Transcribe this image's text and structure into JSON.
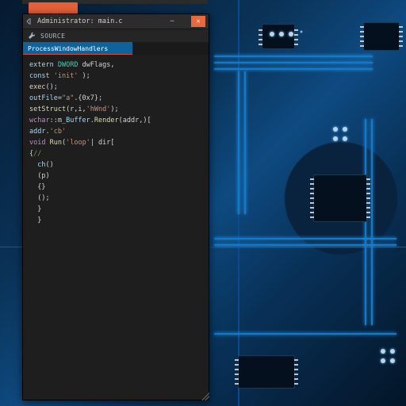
{
  "window": {
    "title": "Administrator: main.c",
    "tab_label": "ProcessWindowHandlers",
    "menu_label": "SOURCE"
  },
  "code": {
    "lines": [
      [
        [
          "va",
          "extern"
        ],
        [
          "pu",
          " "
        ],
        [
          "ty",
          "DWORD"
        ],
        [
          "pu",
          " dwFlags,"
        ]
      ],
      [
        [
          "va",
          "const"
        ],
        [
          "pu",
          " "
        ],
        [
          "st",
          "'init'"
        ],
        [
          "pu",
          " );"
        ]
      ],
      [
        [
          "fn",
          "exec"
        ],
        [
          "op",
          "()"
        ],
        [
          "pu",
          ";"
        ]
      ],
      [
        [
          "va",
          "outFile"
        ],
        [
          "op",
          "="
        ],
        [
          "st",
          "\"a\""
        ],
        [
          "pu",
          ".{0x7};"
        ]
      ],
      [
        [
          "fn",
          "setStruct"
        ],
        [
          "pu",
          "(r,i,"
        ],
        [
          "st",
          "'hWnd'"
        ],
        [
          "pu",
          ");"
        ]
      ],
      [
        [
          "kw",
          "wchar"
        ],
        [
          "op",
          "::"
        ],
        [
          "va",
          "m_Buffer"
        ],
        [
          "pu",
          "."
        ],
        [
          "fn",
          "Render"
        ],
        [
          "pu",
          "(addr,"
        ],
        [
          "pu",
          ")["
        ]
      ],
      [
        [
          "va",
          "addr"
        ],
        [
          "op",
          "."
        ],
        [
          "st",
          "'cb'"
        ]
      ],
      [
        [
          "kw",
          "void"
        ],
        [
          "pu",
          " "
        ],
        [
          "fn",
          "Run"
        ],
        [
          "pu",
          "("
        ],
        [
          "st",
          "'loop'"
        ],
        [
          "pu",
          "| dir["
        ]
      ],
      [
        [
          "pu",
          "{"
        ],
        [
          "cm",
          "//"
        ]
      ],
      [
        [
          "va",
          "  ch"
        ],
        [
          "op",
          "()"
        ]
      ],
      [
        [
          "pu",
          "  (p)"
        ]
      ],
      [
        [
          "pu",
          "  {}"
        ]
      ],
      [
        [
          "pu",
          "  ();"
        ]
      ],
      [
        [
          "pu",
          "  }"
        ]
      ],
      [
        [
          "pu",
          "  }"
        ]
      ]
    ]
  },
  "colors": {
    "accent": "#0e639c",
    "tab_underline": "#d94b33",
    "close_btn": "#e66a3f"
  }
}
